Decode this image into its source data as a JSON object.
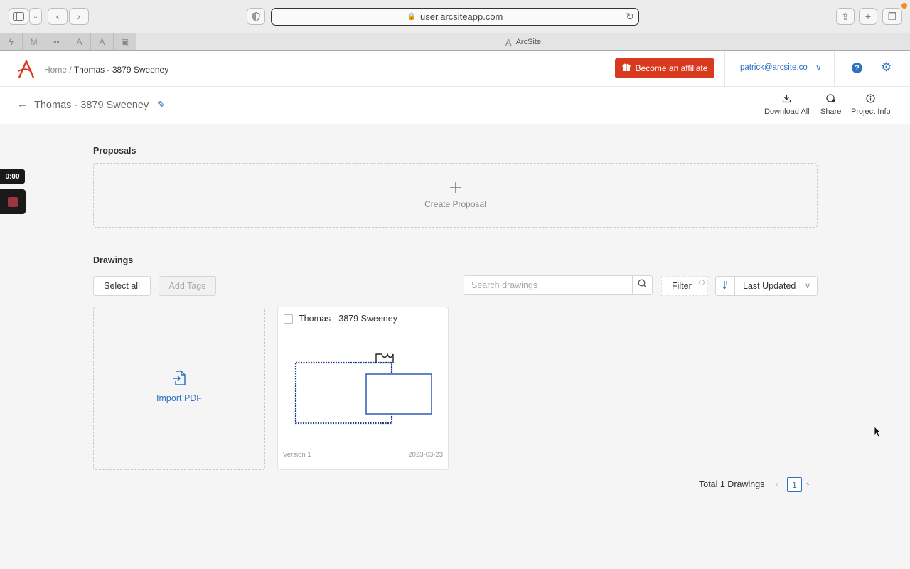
{
  "browser": {
    "url": "user.arcsiteapp.com",
    "tab_title": "ArcSite",
    "pinned_tabs": [
      "tab-1",
      "tab-2",
      "tab-3",
      "tab-4",
      "tab-5",
      "tab-6"
    ]
  },
  "header": {
    "breadcrumb_home": "Home",
    "breadcrumb_sep": "/",
    "breadcrumb_current": "Thomas - 3879 Sweeney",
    "affiliate_label": "Become an affiliate",
    "account_email": "patrick@arcsite.co",
    "accent_color": "#2c72c4",
    "brand_color": "#d9391f"
  },
  "project": {
    "title": "Thomas - 3879 Sweeney",
    "actions": [
      {
        "label": "Download All",
        "icon": "download-icon"
      },
      {
        "label": "Share",
        "icon": "share-icon"
      },
      {
        "label": "Project Info",
        "icon": "info-icon"
      }
    ]
  },
  "recording": {
    "time": "0:00"
  },
  "proposals": {
    "title": "Proposals",
    "create_label": "Create Proposal"
  },
  "drawings": {
    "title": "Drawings",
    "select_all": "Select all",
    "add_tags": "Add Tags",
    "search_placeholder": "Search drawings",
    "filter_label": "Filter",
    "sort_value": "Last Updated",
    "import_label": "Import PDF",
    "items": [
      {
        "name": "Thomas - 3879 Sweeney",
        "version": "Version 1",
        "date": "2023-03-23"
      }
    ],
    "total_label": "Total 1 Drawings",
    "current_page": "1"
  }
}
